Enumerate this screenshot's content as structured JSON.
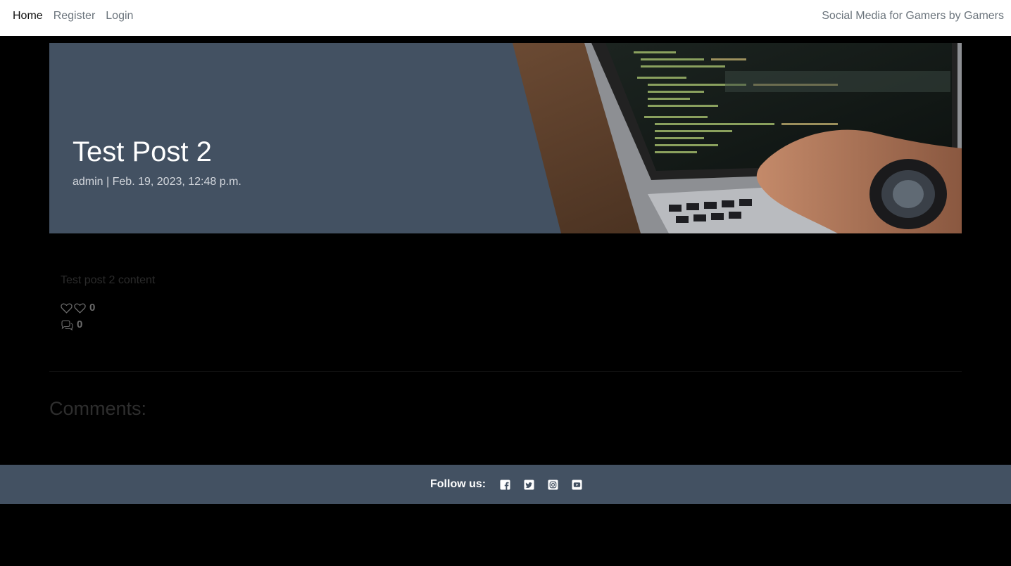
{
  "nav": {
    "links": [
      {
        "label": "Home",
        "active": true
      },
      {
        "label": "Register",
        "active": false
      },
      {
        "label": "Login",
        "active": false
      }
    ],
    "brand": "Social Media for Gamers by Gamers"
  },
  "post": {
    "title": "Test Post 2",
    "author": "admin",
    "separator": "|",
    "date": "Feb. 19, 2023, 12:48 p.m.",
    "meta": "admin | Feb. 19, 2023, 12:48 p.m.",
    "content": "Test post 2 content",
    "likes": "0",
    "comment_count": "0",
    "hero_image": "laptop-code-photo"
  },
  "comments": {
    "heading": "Comments:"
  },
  "footer": {
    "follow_label": "Follow us:",
    "social": [
      "facebook-icon",
      "twitter-icon",
      "instagram-icon",
      "youtube-icon"
    ]
  },
  "colors": {
    "nav_bg": "#ffffff",
    "page_bg": "#000000",
    "hero_bg": "#435162",
    "footer_bg": "#435162"
  }
}
